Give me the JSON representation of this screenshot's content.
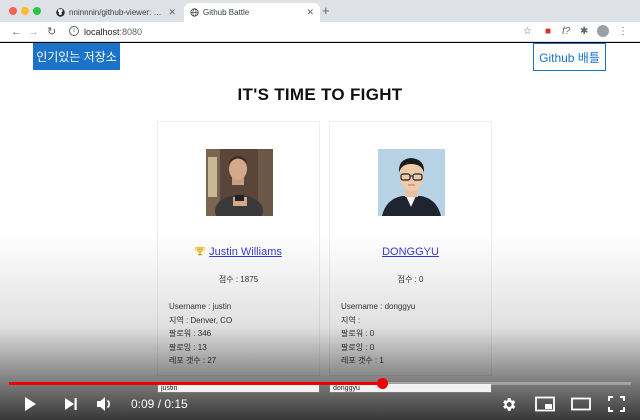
{
  "browser": {
    "tabs": [
      {
        "title": "nninnnin/github-viewer: React",
        "icon": "github-icon",
        "active": false
      },
      {
        "title": "Github Battle",
        "icon": "globe-icon",
        "active": true
      }
    ],
    "new_tab": "+",
    "url": {
      "host": "localhost",
      "port": ":8080"
    }
  },
  "nav": {
    "popular": "인기있는 저장소",
    "battle": "Github 배틀"
  },
  "page_title": "IT'S TIME TO FIGHT",
  "players": [
    {
      "name": "Justin Williams",
      "winner": true,
      "score": "점수 : 1875",
      "username": "Username : justin",
      "location": "지역 : Denver, CO",
      "followers": "팔로워 : 346",
      "following": "팔로잉 : 13",
      "repos": "레포 갯수 : 27",
      "input_value": "justin"
    },
    {
      "name": "DONGGYU",
      "winner": false,
      "score": "점수 : 0",
      "username": "Username : donggyu",
      "location": "지역 :",
      "followers": "팔로워 : 0",
      "following": "팔로잉 : 0",
      "repos": "레포 갯수 : 1",
      "input_value": "donggyu"
    }
  ],
  "player": {
    "time": "0:09 / 0:15",
    "progress": 0.6
  },
  "colors": {
    "accent": "#1a73c8",
    "link": "#3b3bd6",
    "progress": "#ee0000"
  }
}
